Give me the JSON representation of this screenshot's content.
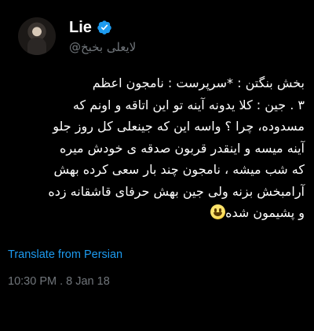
{
  "author": {
    "display_name": "Lie",
    "handle": "@لایعلی بخبخ",
    "verified": true
  },
  "tweet": {
    "lines": [
      "بخش بنگتن : *سرپرست : نامجون اعظم",
      "۳ . جین : کلا یدونه آینه تو این اتاقه و اونم که",
      "مسدوده، چرا ؟ واسه این که جینعلی کل روز جلو",
      "آینه میسه و اینقدر قربون صدقه ی خودش میره",
      "که شب میشه ، نامجون چند بار سعی کرده بهش",
      "آرامبخش بزنه ولی جین بهش حرفای قاشقانه زده",
      "و پشیمون شده"
    ],
    "emoji": "grinning-face",
    "translate_label": "Translate from Persian",
    "timestamp": "10:30 PM . 8 Jan 18"
  },
  "colors": {
    "background": "#000000",
    "text": "#ffffff",
    "secondary": "#71767b",
    "accent": "#1d9bf0"
  }
}
